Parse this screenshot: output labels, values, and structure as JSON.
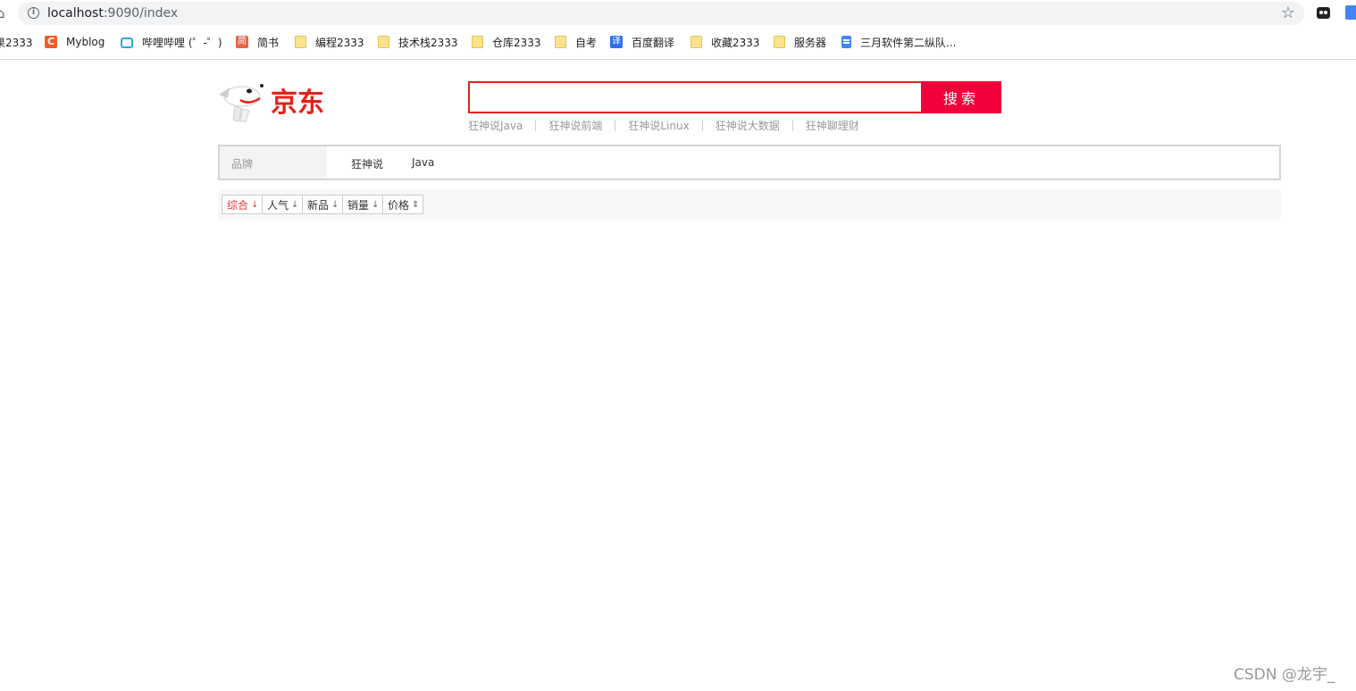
{
  "browser": {
    "url_host": "localhost",
    "url_path": ":9090/index",
    "bookmarks": [
      {
        "label": "果2333",
        "icon": "none"
      },
      {
        "label": "Myblog",
        "icon": "csdn-icon"
      },
      {
        "label": "哔哩哔哩 (゜-゜)",
        "icon": "bilibili-icon"
      },
      {
        "label": "简书",
        "icon": "jianshu-icon"
      },
      {
        "label": "编程2333",
        "icon": "folder-icon"
      },
      {
        "label": "技术栈2333",
        "icon": "folder-icon"
      },
      {
        "label": "仓库2333",
        "icon": "folder-icon"
      },
      {
        "label": "自考",
        "icon": "folder-icon"
      },
      {
        "label": "百度翻译",
        "icon": "translate-icon"
      },
      {
        "label": "收藏2333",
        "icon": "folder-icon"
      },
      {
        "label": "服务器",
        "icon": "folder-icon"
      },
      {
        "label": "三月软件第二纵队...",
        "icon": "document-icon"
      }
    ]
  },
  "header": {
    "logo_text": "京东",
    "search_value": "",
    "search_button": "搜索",
    "hotwords": [
      "狂神说Java",
      "狂神说前端",
      "狂神说Linux",
      "狂神说大数据",
      "狂神聊理财"
    ]
  },
  "filter": {
    "key": "品牌",
    "values": [
      "狂神说",
      "Java"
    ]
  },
  "sort": {
    "items": [
      {
        "label": "综合",
        "arrow": "↓",
        "active": true
      },
      {
        "label": "人气",
        "arrow": "↓",
        "active": false
      },
      {
        "label": "新品",
        "arrow": "↓",
        "active": false
      },
      {
        "label": "销量",
        "arrow": "↓",
        "active": false
      },
      {
        "label": "价格",
        "arrow": "⇕",
        "active": false
      }
    ]
  },
  "watermark": "CSDN @龙宇_",
  "colors": {
    "brand_red": "#e2231a",
    "search_button": "#f2003b"
  }
}
